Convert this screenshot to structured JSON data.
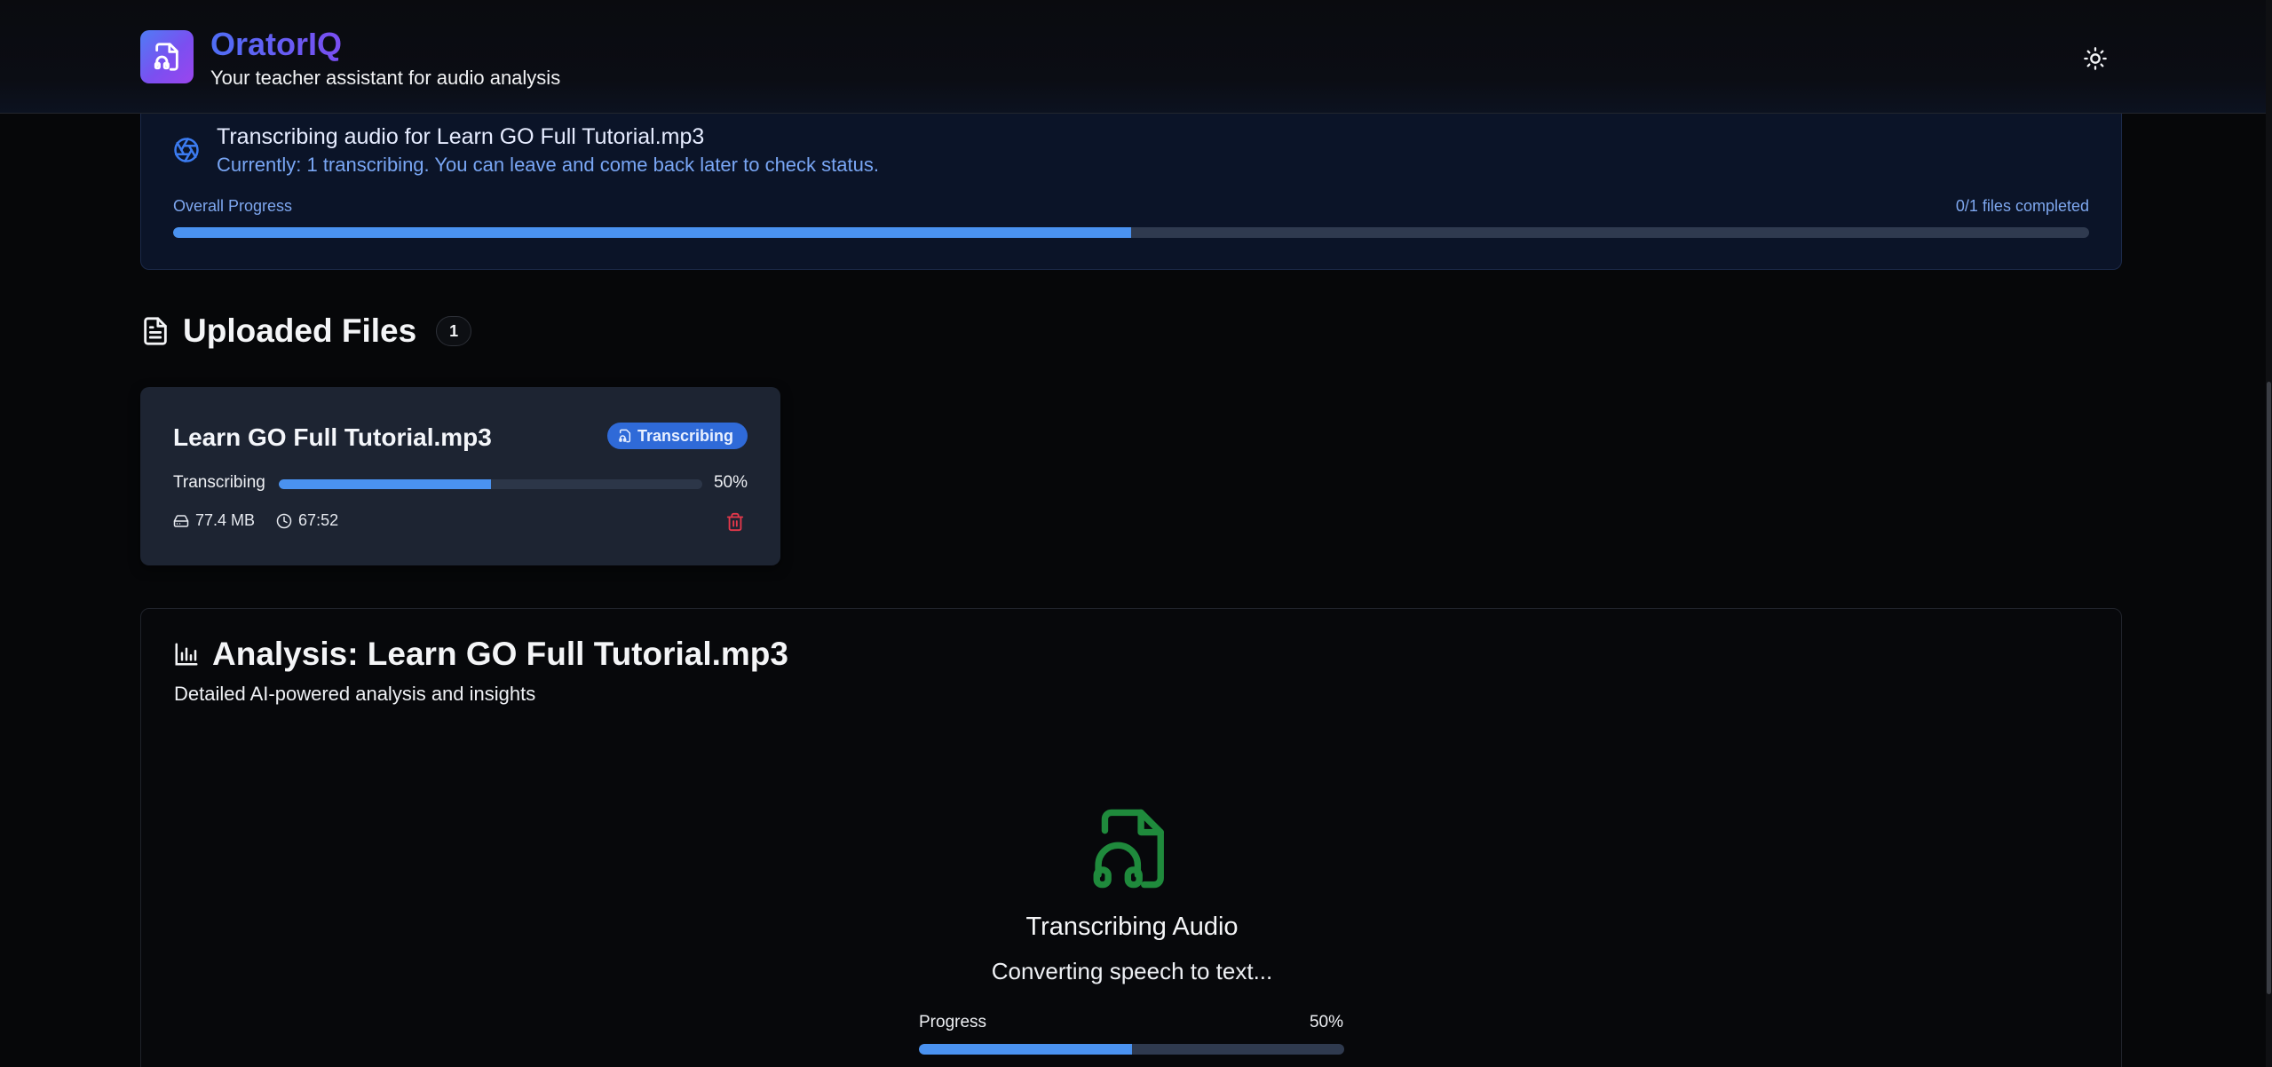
{
  "header": {
    "app_name": "OratorIQ",
    "tagline": "Your teacher assistant for audio analysis",
    "logo_icon": "file-headphones-icon",
    "theme_toggle_icon": "sun-icon"
  },
  "banner": {
    "icon": "loader-icon",
    "title": "Transcribing audio for Learn GO Full Tutorial.mp3",
    "subtitle": "Currently: 1 transcribing. You can leave and come back later to check status.",
    "progress_label": "Overall Progress",
    "progress_count": "0/1 files completed",
    "progress_value": 0.5
  },
  "uploaded": {
    "title": "Uploaded Files",
    "count": "1",
    "icon": "document-icon",
    "files": [
      {
        "name": "Learn GO Full Tutorial.mp3",
        "status": "Transcribing",
        "progress_label": "Transcribing",
        "progress_pct": "50%",
        "progress_value": 0.5,
        "size": "77.4 MB",
        "duration": "67:52"
      }
    ]
  },
  "analysis": {
    "title": "Analysis: Learn GO Full Tutorial.mp3",
    "subtitle": "Detailed AI-powered analysis and insights",
    "icon": "bar-chart-icon",
    "state_title": "Transcribing Audio",
    "state_subtitle": "Converting speech to text...",
    "progress_label": "Progress",
    "progress_pct": "50%",
    "progress_value": 0.5
  },
  "colors": {
    "accent_blue": "#4a92f0",
    "status_pill": "#2f6ad8",
    "delete_red": "#e5384b",
    "audio_icon_green": "#1f8a3c",
    "brand_gradient_start": "#4f6ef5",
    "brand_gradient_end": "#7a4ef2"
  }
}
